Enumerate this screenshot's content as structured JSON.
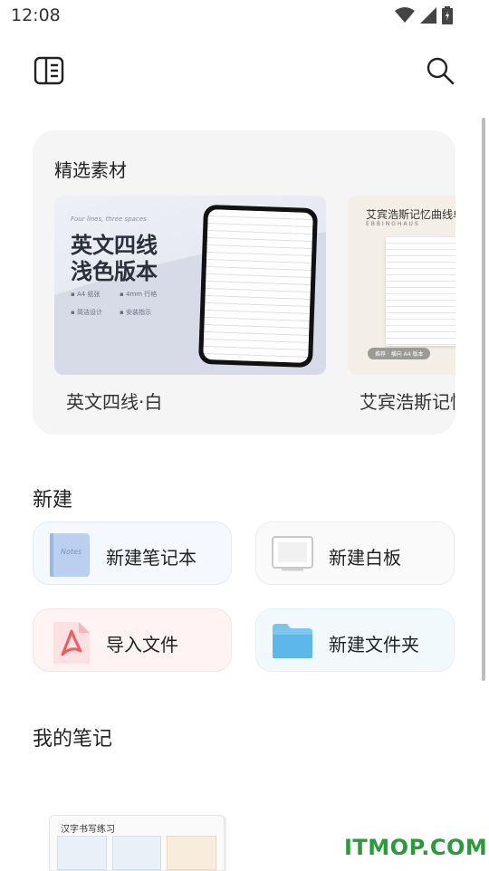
{
  "status": {
    "time": "12:08"
  },
  "featured": {
    "title": "精选素材",
    "items": [
      {
        "caption": "英文四线·白",
        "script": "Four lines, three spaces",
        "heading_line1": "英文四线",
        "heading_line2": "浅色版本",
        "bullets": [
          "A4 纸张",
          "4mm 行格",
          "简洁设计",
          "安装指示"
        ]
      },
      {
        "caption": "艾宾浩斯记忆曲线",
        "heading": "艾宾浩斯记忆曲线单",
        "sub": "EBBINGHAUS",
        "badge": "推荐 · 横向 A4 版本"
      }
    ]
  },
  "new_section": {
    "title": "新建",
    "tiles": {
      "notebook": {
        "label": "新建笔记本",
        "cover_text": "Notes"
      },
      "whiteboard": {
        "label": "新建白板"
      },
      "import": {
        "label": "导入文件"
      },
      "folder": {
        "label": "新建文件夹"
      }
    }
  },
  "my_notes": {
    "title": "我的笔记",
    "thumb_text": "汉字书写练习"
  },
  "watermark": "ITMOP.COM",
  "colors": {
    "accent_green": "#2a9a3a",
    "pdf_red": "#f25c5c",
    "folder_blue": "#5cb8ea"
  }
}
